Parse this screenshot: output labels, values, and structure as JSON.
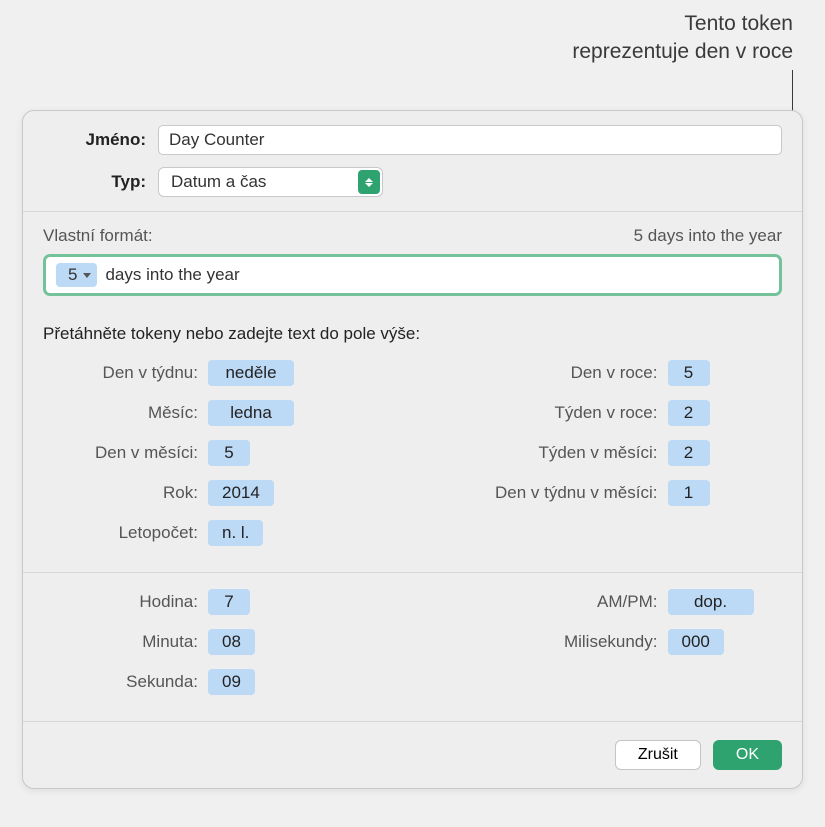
{
  "callout": {
    "line1": "Tento token",
    "line2": "reprezentuje den v roce"
  },
  "fields": {
    "name_label": "Jméno:",
    "name_value": "Day Counter",
    "type_label": "Typ:",
    "type_value": "Datum a čas"
  },
  "format": {
    "label": "Vlastní formát:",
    "preview": "5 days into the year",
    "token_value": "5",
    "suffix_text": "days into the year"
  },
  "drag_hint": "Přetáhněte tokeny nebo zadejte text do pole výše:",
  "tokens_left": [
    {
      "label": "Den v týdnu:",
      "value": "neděle"
    },
    {
      "label": "Měsíc:",
      "value": "ledna"
    },
    {
      "label": "Den v měsíci:",
      "value": "5"
    },
    {
      "label": "Rok:",
      "value": "2014"
    },
    {
      "label": "Letopočet:",
      "value": "n. l."
    }
  ],
  "tokens_right": [
    {
      "label": "Den v roce:",
      "value": "5"
    },
    {
      "label": "Týden v roce:",
      "value": "2"
    },
    {
      "label": "Týden v měsíci:",
      "value": "2"
    },
    {
      "label": "Den v týdnu v měsíci:",
      "value": "1"
    }
  ],
  "time_left": [
    {
      "label": "Hodina:",
      "value": "7"
    },
    {
      "label": "Minuta:",
      "value": "08"
    },
    {
      "label": "Sekunda:",
      "value": "09"
    }
  ],
  "time_right": [
    {
      "label": "AM/PM:",
      "value": "dop."
    },
    {
      "label": "Milisekundy:",
      "value": "000"
    }
  ],
  "buttons": {
    "cancel": "Zrušit",
    "ok": "OK"
  }
}
